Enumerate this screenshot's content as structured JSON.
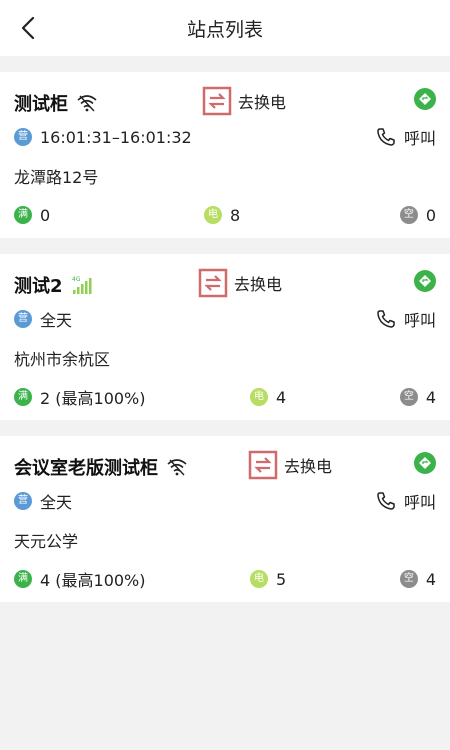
{
  "header": {
    "title": "站点列表"
  },
  "swap_label": "去换电",
  "call_label": "呼叫",
  "badges": {
    "open": "营",
    "full": "满",
    "charging": "电",
    "empty": "空"
  },
  "signal_4g_label": "4G",
  "colors": {
    "swap_red": "#d06b6b",
    "nav_green": "#3bb34a",
    "open_blue": "#5b9bd5",
    "full_green": "#3bb34a",
    "charging_lime": "#b7dd62",
    "empty_gray": "#8c8c8c"
  },
  "stations": [
    {
      "name": "测试柜",
      "signal": "wifi-icon",
      "hours": "16:01:31–16:01:32",
      "address": "龙潭路12号",
      "full": "0",
      "charging": "8",
      "empty": "0"
    },
    {
      "name": "测试2",
      "signal": "4g-signal-icon",
      "hours": "全天",
      "address": "杭州市余杭区",
      "full": "2 (最高100%)",
      "charging": "4",
      "empty": "4"
    },
    {
      "name": "会议室老版测试柜",
      "signal": "wifi-icon",
      "hours": "全天",
      "address": "天元公学",
      "full": "4 (最高100%)",
      "charging": "5",
      "empty": "4"
    }
  ]
}
